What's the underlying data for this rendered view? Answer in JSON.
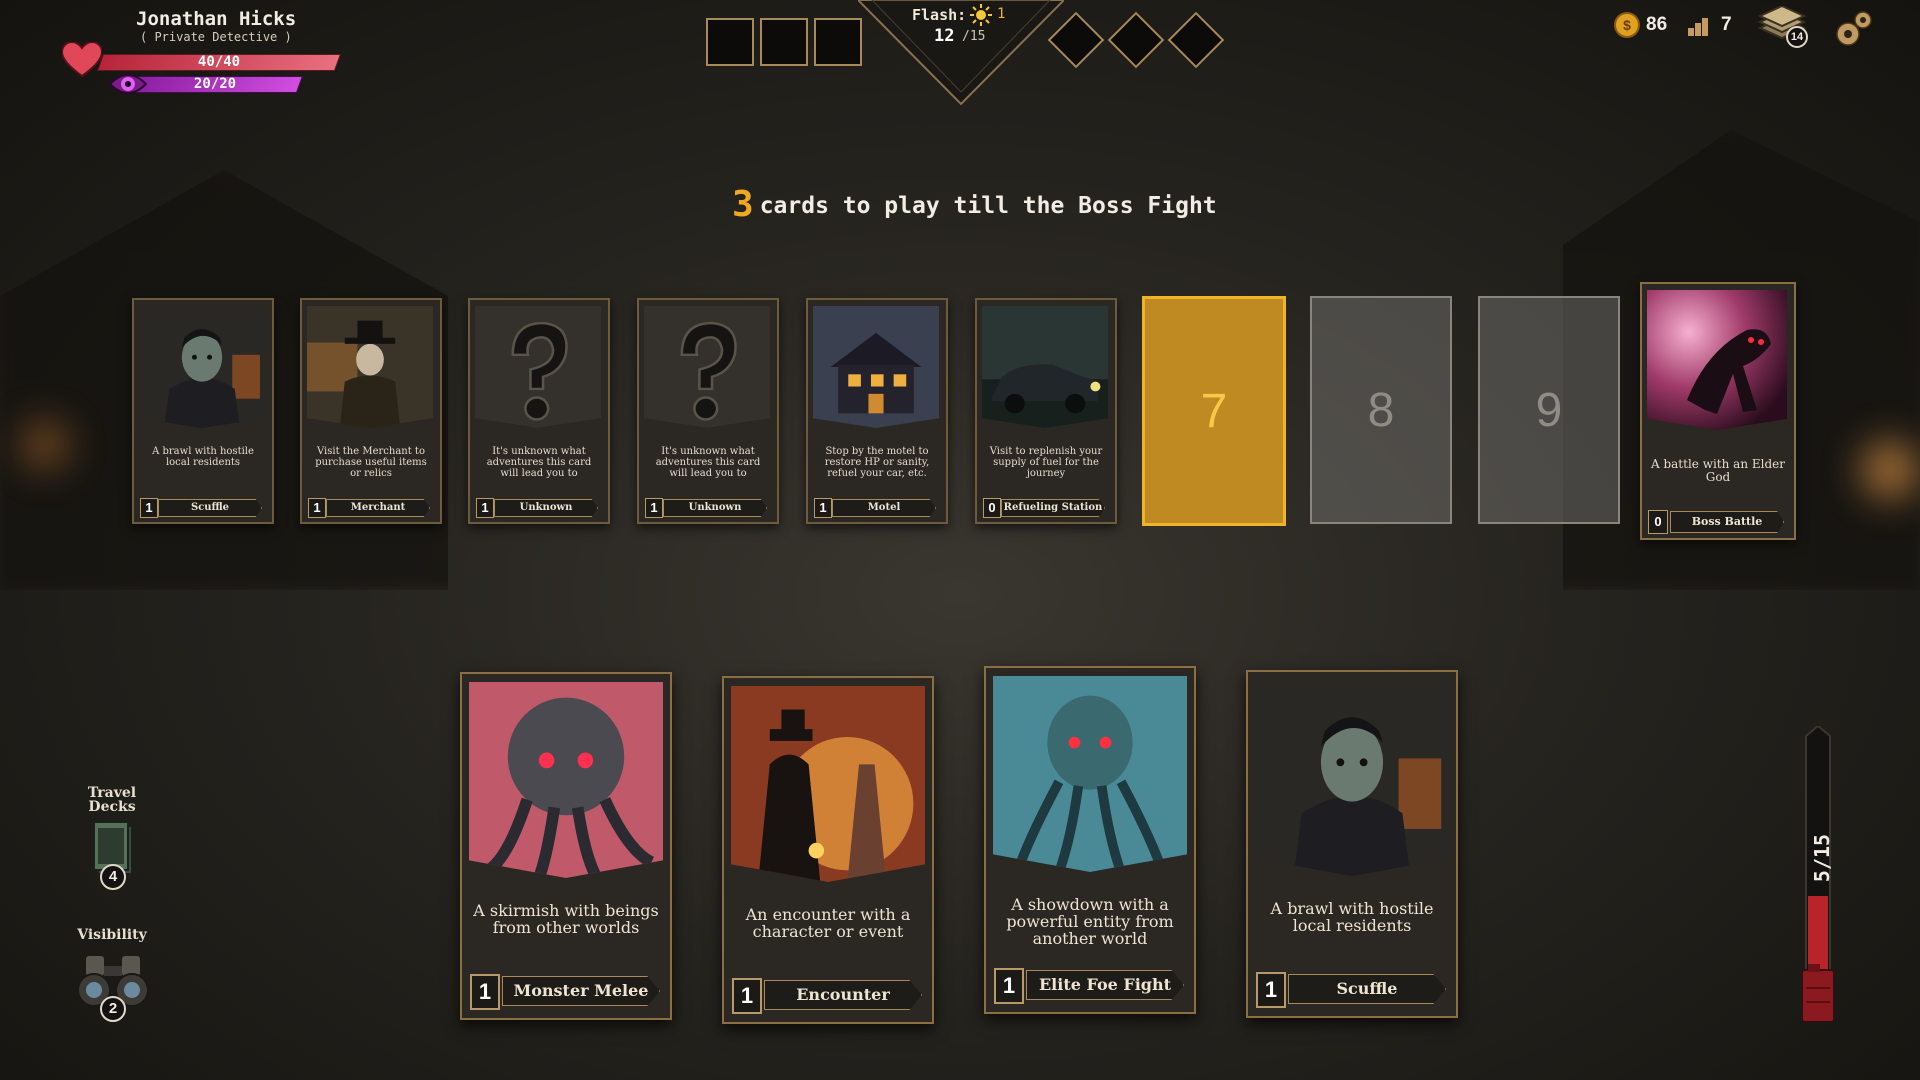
{
  "player": {
    "name": "Jonathan Hicks",
    "class": "( Private Detective )",
    "hp_text": "40/40",
    "hp": 40,
    "hp_max": 40,
    "sanity_text": "20/20",
    "sanity": 20,
    "sanity_max": 20
  },
  "status": {
    "flash_label": "Flash:",
    "flash_value": "1",
    "turn_current": "12",
    "turn_max": "/15",
    "square_slots": 3,
    "diamond_slots": 3
  },
  "resources": {
    "coins": "86",
    "level": "7",
    "deck_count": "14"
  },
  "headline": {
    "count": "3",
    "text": "cards to play till the Boss Fight"
  },
  "path_cards": [
    {
      "name": "Scuffle",
      "cost": "1",
      "desc": "A brawl with hostile local residents",
      "art": "thug"
    },
    {
      "name": "Merchant",
      "cost": "1",
      "desc": "Visit the Merchant to purchase useful items or relics",
      "art": "merchant"
    },
    {
      "name": "Unknown",
      "cost": "1",
      "desc": "It's unknown what adventures this card will lead you to",
      "art": "unknown"
    },
    {
      "name": "Unknown",
      "cost": "1",
      "desc": "It's unknown what adventures this card will lead you to",
      "art": "unknown"
    },
    {
      "name": "Motel",
      "cost": "1",
      "desc": "Stop by the motel to restore HP or sanity, refuel your car, etc.",
      "art": "motel"
    },
    {
      "name": "Refueling Station",
      "cost": "0",
      "desc": "Visit to replenish your supply of fuel for the journey",
      "art": "car"
    }
  ],
  "empty_slots": [
    "7",
    "8",
    "9"
  ],
  "boss_card": {
    "name": "Boss Battle",
    "cost": "0",
    "desc": "A battle with an Elder God"
  },
  "hand_cards": [
    {
      "name": "Monster Melee",
      "cost": "1",
      "desc": "A skirmish with beings from other worlds",
      "art": "monster"
    },
    {
      "name": "Encounter",
      "cost": "1",
      "desc": "An encounter with a character or event",
      "art": "encounter"
    },
    {
      "name": "Elite Foe Fight",
      "cost": "1",
      "desc": "A showdown with a powerful entity from another world",
      "art": "elite"
    },
    {
      "name": "Scuffle",
      "cost": "1",
      "desc": "A brawl with hostile local residents",
      "art": "thug"
    }
  ],
  "side": {
    "travel_label": "Travel Decks",
    "travel_count": "4",
    "visibility_label": "Visibility",
    "visibility_value": "2"
  },
  "fuel": {
    "text": "5/15",
    "value": 5,
    "max": 15
  },
  "colors": {
    "accent": "#f0b429",
    "hp": "#d94a5a",
    "sanity": "#c03cd8",
    "fuel": "#b8242a"
  },
  "icons": [
    "heart-icon",
    "eye-icon",
    "sun-icon",
    "coin-icon",
    "level-icon",
    "deck-icon",
    "gear-icon",
    "binoculars-icon",
    "fuel-can-icon"
  ]
}
